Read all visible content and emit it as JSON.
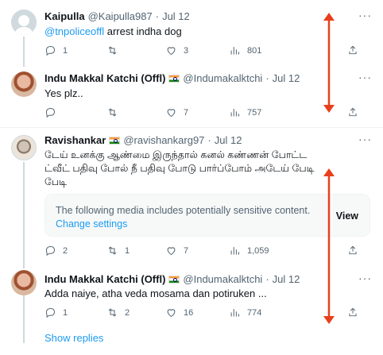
{
  "tweets": [
    {
      "name": "Kaipulla",
      "handle": "@Kaipulla987",
      "dot": "·",
      "date": "Jul 12",
      "mention": "@tnpoliceoffl",
      "text": " arrest indha dog",
      "replies": "1",
      "retweets": "",
      "likes": "3",
      "views": "801"
    },
    {
      "name": "Indu Makkal Katchi (Offl)",
      "handle": "@Indumakalktchi",
      "dot": "·",
      "date": "Jul 12",
      "text": "Yes plz..",
      "replies": "",
      "retweets": "",
      "likes": "7",
      "views": "757"
    },
    {
      "name": "Ravishankar",
      "handle": "@ravishankarg97",
      "dot": "·",
      "date": "Jul 12",
      "text": "டேய் உனக்கு ஆண்மை இருந்தால் கனல் கண்ணன் போட்ட ட்வீட் பதிவு போல் நீ பதிவு போடு பார்ப்போம் அடேய் பேடி பேடி",
      "sensitive_message": "The following media includes potentially sensitive content.",
      "sensitive_link": "Change settings",
      "sensitive_view": "View",
      "replies": "2",
      "retweets": "1",
      "likes": "7",
      "views": "1,059"
    },
    {
      "name": "Indu Makkal Katchi (Offl)",
      "handle": "@Indumakalktchi",
      "dot": "·",
      "date": "Jul 12",
      "text": "Adda naiye, atha veda mosama dan potiruken ...",
      "replies": "1",
      "retweets": "2",
      "likes": "16",
      "views": "774"
    }
  ],
  "more_label": "···",
  "show_replies": "Show replies",
  "colors": {
    "accent": "#1d9bf0",
    "annotation_arrow": "#e8401c",
    "muted": "#536471"
  },
  "icons": [
    "reply-icon",
    "retweet-icon",
    "like-icon",
    "views-icon",
    "share-icon",
    "more-icon",
    "india-flag-icon"
  ]
}
